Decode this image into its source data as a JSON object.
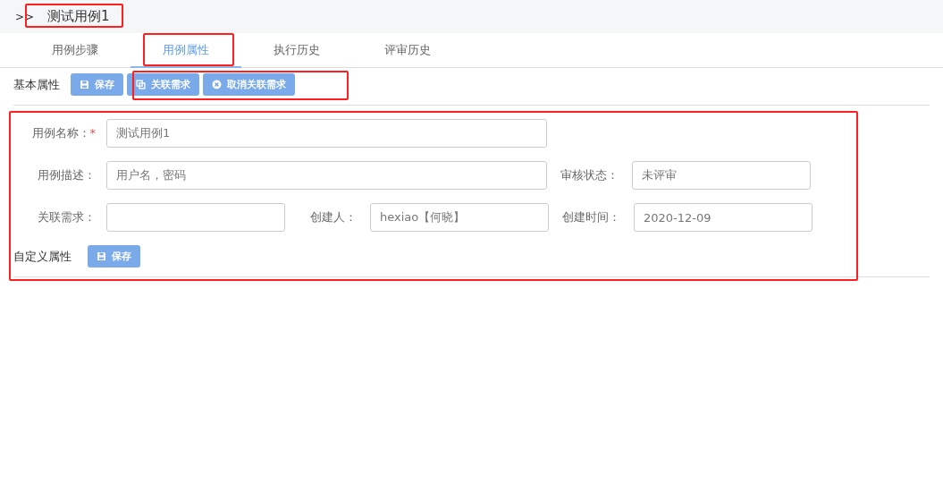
{
  "breadcrumb": {
    "marker": ">>",
    "title": "测试用例1"
  },
  "tabs": [
    {
      "label": "用例步骤",
      "selected": false
    },
    {
      "label": "用例属性",
      "selected": true
    },
    {
      "label": "执行历史",
      "selected": false
    },
    {
      "label": "评审历史",
      "selected": false
    }
  ],
  "basic_section": {
    "title": "基本属性",
    "buttons": [
      {
        "label": "保存",
        "kind": "save"
      },
      {
        "label": "关联需求",
        "kind": "link"
      },
      {
        "label": "取消关联需求",
        "kind": "unlink"
      }
    ]
  },
  "form": {
    "name": {
      "label": "用例名称：",
      "required_mark": "*",
      "value": "测试用例1"
    },
    "description": {
      "label": "用例描述：",
      "value": "用户名，密码"
    },
    "review_status": {
      "label": "审核状态：",
      "value": "未评审"
    },
    "linked_requirement": {
      "label": "关联需求："
    },
    "creator": {
      "label": "创建人：",
      "value": "hexiao【何晓】"
    },
    "created_time": {
      "label": "创建时间：",
      "value": "2020-12-09"
    }
  },
  "custom_section": {
    "title": "自定义属性",
    "buttons": [
      {
        "label": "保存",
        "kind": "save"
      }
    ]
  }
}
